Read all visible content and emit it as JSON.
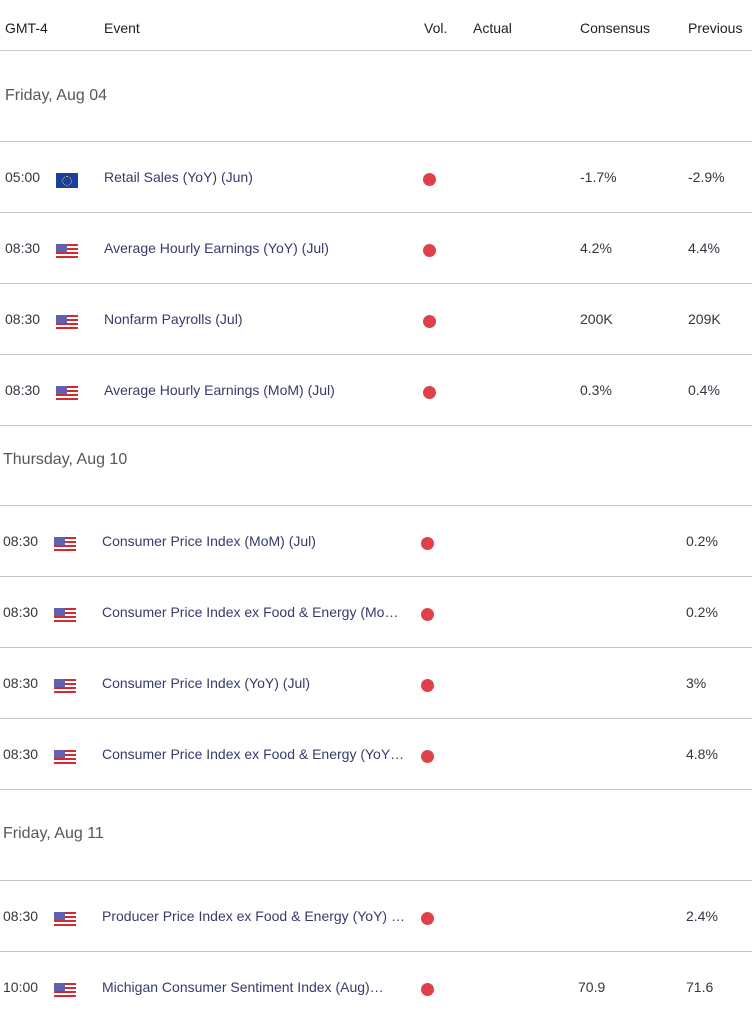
{
  "header": {
    "timezone": "GMT-4",
    "event": "Event",
    "vol": "Vol.",
    "actual": "Actual",
    "consensus": "Consensus",
    "previous": "Previous"
  },
  "colors": {
    "volatility_high": "#e0404a",
    "event_text": "#363b6a"
  },
  "days": [
    {
      "label": "Friday, Aug 04",
      "events": [
        {
          "time": "05:00",
          "flag": "eu-flag",
          "event": "Retail Sales (YoY) (Jun)",
          "vol": "high",
          "actual": "",
          "consensus": "-1.7%",
          "previous": "-2.9%"
        },
        {
          "time": "08:30",
          "flag": "us-flag",
          "event": "Average Hourly Earnings (YoY) (Jul)",
          "vol": "high",
          "actual": "",
          "consensus": "4.2%",
          "previous": "4.4%"
        },
        {
          "time": "08:30",
          "flag": "us-flag",
          "event": "Nonfarm Payrolls (Jul)",
          "vol": "high",
          "actual": "",
          "consensus": "200K",
          "previous": "209K"
        },
        {
          "time": "08:30",
          "flag": "us-flag",
          "event": "Average Hourly Earnings (MoM) (Jul)",
          "vol": "high",
          "actual": "",
          "consensus": "0.3%",
          "previous": "0.4%"
        }
      ]
    },
    {
      "label": "Thursday, Aug 10",
      "events": [
        {
          "time": "08:30",
          "flag": "us-flag",
          "event": "Consumer Price Index (MoM) (Jul)",
          "vol": "high",
          "actual": "",
          "consensus": "",
          "previous": "0.2%"
        },
        {
          "time": "08:30",
          "flag": "us-flag",
          "event": "Consumer Price Index ex Food & Energy (Mo…",
          "vol": "high",
          "actual": "",
          "consensus": "",
          "previous": "0.2%"
        },
        {
          "time": "08:30",
          "flag": "us-flag",
          "event": "Consumer Price Index (YoY) (Jul)",
          "vol": "high",
          "actual": "",
          "consensus": "",
          "previous": "3%"
        },
        {
          "time": "08:30",
          "flag": "us-flag",
          "event": "Consumer Price Index ex Food & Energy (YoY…",
          "vol": "high",
          "actual": "",
          "consensus": "",
          "previous": "4.8%"
        }
      ]
    },
    {
      "label": "Friday, Aug 11",
      "events": [
        {
          "time": "08:30",
          "flag": "us-flag",
          "event": "Producer Price Index ex Food & Energy (YoY) …",
          "vol": "high",
          "actual": "",
          "consensus": "",
          "previous": "2.4%"
        },
        {
          "time": "10:00",
          "flag": "us-flag",
          "event": "Michigan Consumer Sentiment Index (Aug)…",
          "vol": "high",
          "actual": "",
          "consensus": "70.9",
          "previous": "71.6"
        }
      ]
    }
  ]
}
